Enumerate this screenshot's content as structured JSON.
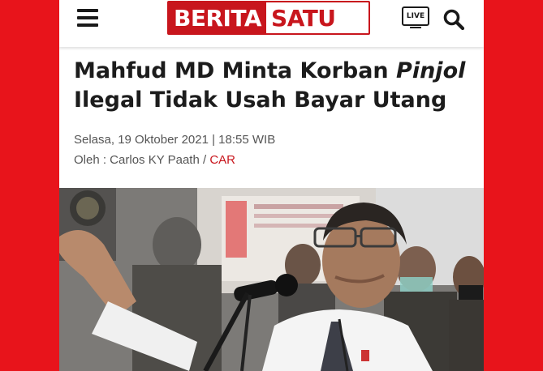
{
  "header": {
    "logo_part1": "BERITA",
    "logo_part2": "SATU",
    "live_label": "LIVE",
    "brand_color": "#c8161d",
    "frame_color": "#e8141b",
    "icons": [
      "menu-icon",
      "live-tv-icon",
      "search-icon"
    ]
  },
  "article": {
    "title_part1": "Mahfud MD Minta Korban ",
    "title_italic": "Pinjol",
    "title_part2": "Ilegal Tidak Usah Bayar Utang",
    "date": "Selasa, 19 Oktober 2021 | 18:55 WIB",
    "author_prefix": "Oleh : Carlos KY Paath / ",
    "editor": "CAR"
  }
}
